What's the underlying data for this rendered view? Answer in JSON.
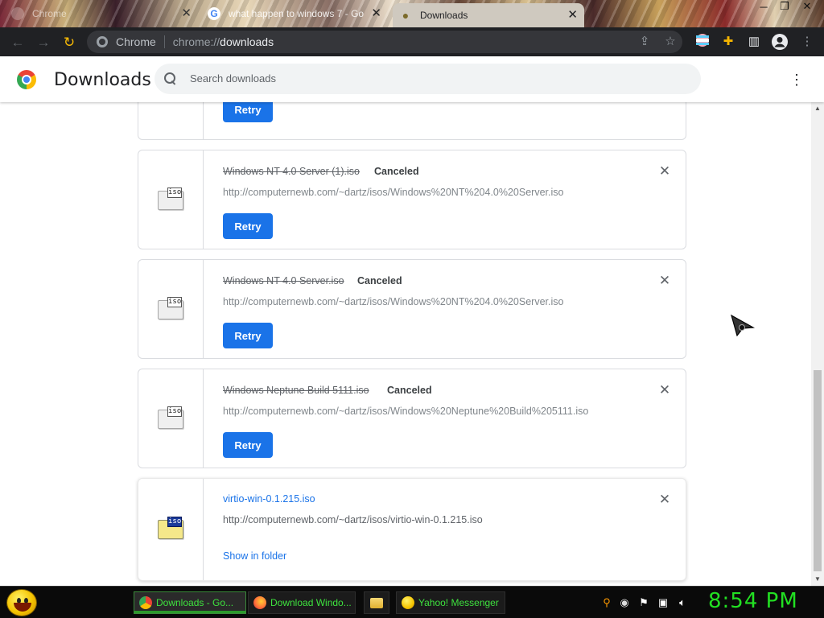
{
  "browser": {
    "tabs": [
      {
        "title": "Chrome",
        "active": false
      },
      {
        "title": "what happen to windows 7 - Go",
        "active": false
      },
      {
        "title": "Downloads",
        "active": true
      }
    ],
    "omnibox": {
      "site_label": "Chrome",
      "scheme": "chrome://",
      "host": "downloads"
    }
  },
  "page": {
    "title": "Downloads",
    "search_placeholder": "Search downloads"
  },
  "downloads": [
    {
      "action": "Retry"
    },
    {
      "name": "Windows NT 4.0 Server (1).iso",
      "status": "Canceled",
      "url": "http://computernewb.com/~dartz/isos/Windows%20NT%204.0%20Server.iso",
      "action": "Retry",
      "icon_label": "iso"
    },
    {
      "name": "Windows NT 4.0 Server.iso",
      "status": "Canceled",
      "url": "http://computernewb.com/~dartz/isos/Windows%20NT%204.0%20Server.iso",
      "action": "Retry",
      "icon_label": "iso"
    },
    {
      "name": "Windows Neptune Build 5111.iso",
      "status": "Canceled",
      "url": "http://computernewb.com/~dartz/isos/Windows%20Neptune%20Build%205111.iso",
      "action": "Retry",
      "icon_label": "iso"
    },
    {
      "name": "virtio-win-0.1.215.iso",
      "status": "",
      "url": "http://computernewb.com/~dartz/isos/virtio-win-0.1.215.iso",
      "action": "Show in folder",
      "icon_label": "iso"
    }
  ],
  "taskbar": {
    "items": [
      {
        "label": "Downloads - Go..."
      },
      {
        "label": "Download Windo..."
      },
      {
        "label": ""
      },
      {
        "label": "Yahoo! Messenger"
      }
    ],
    "clock": "8:54 PM"
  },
  "colors": {
    "accent": "#1a73e8",
    "clock": "#22e022",
    "toolbar": "#202124"
  }
}
